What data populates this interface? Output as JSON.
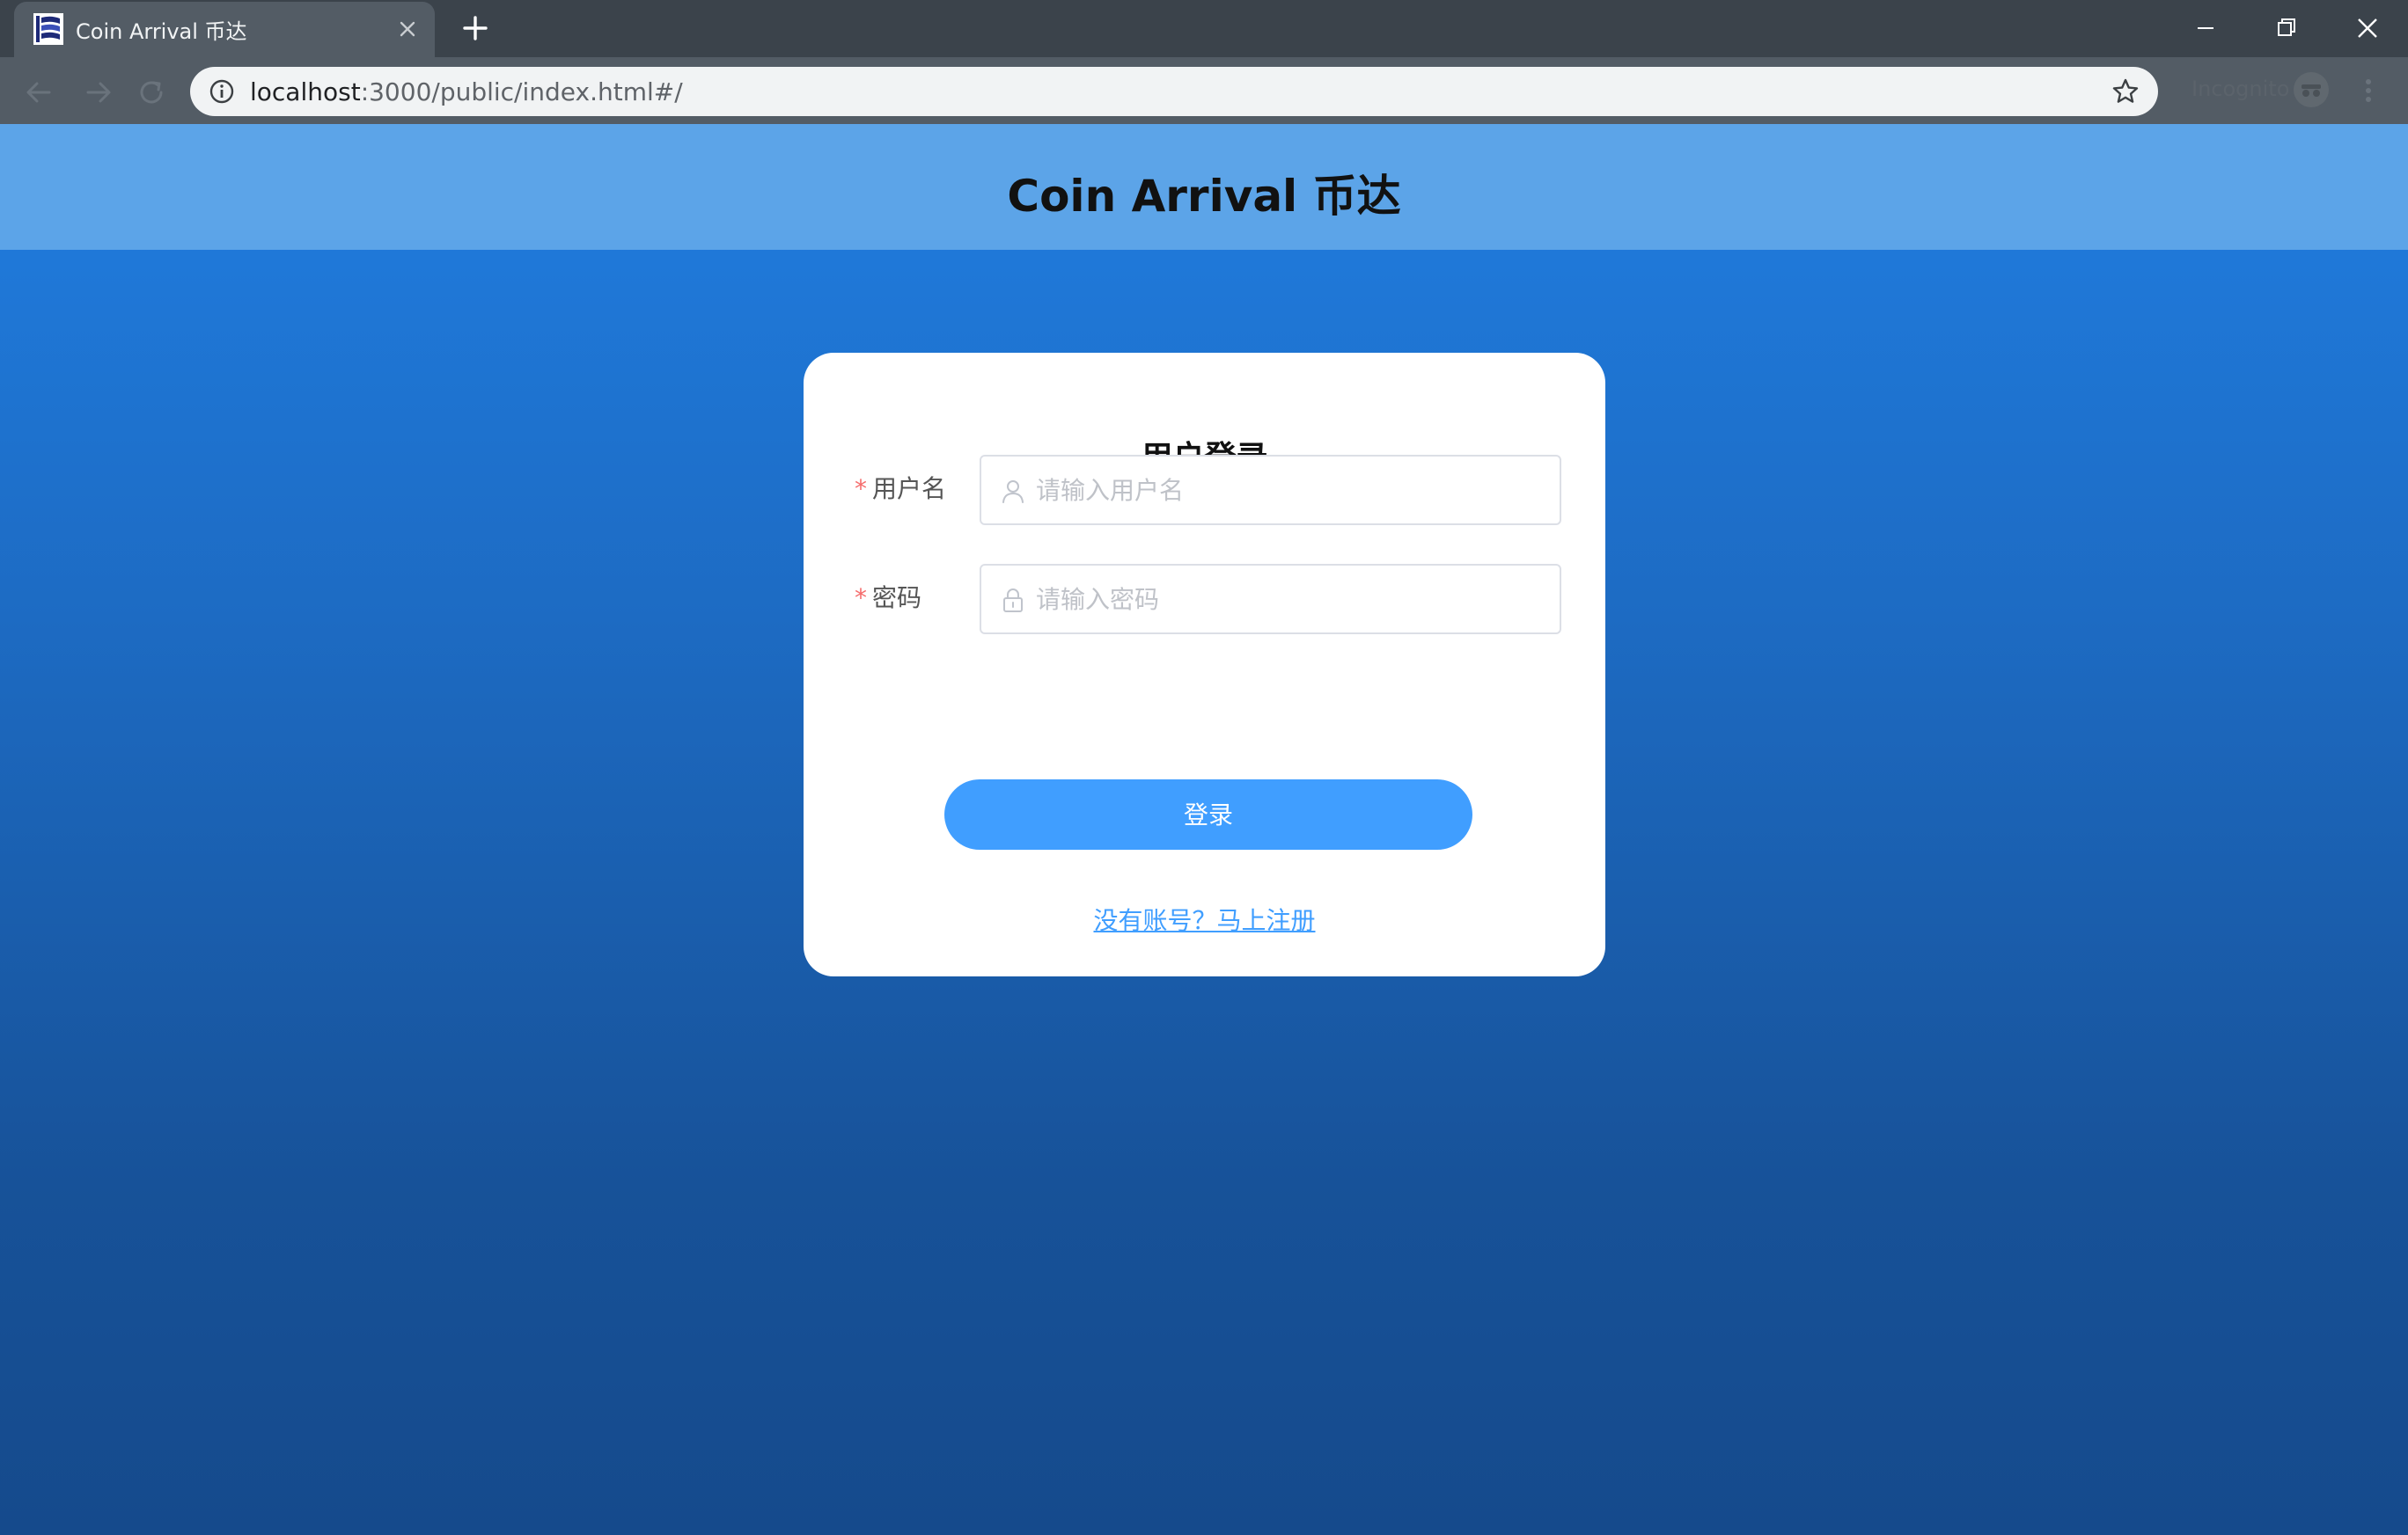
{
  "browser": {
    "tab": {
      "title": "Coin Arrival 币达"
    },
    "address": {
      "host": "localhost",
      "path": ":3000/public/index.html#/"
    },
    "incognito_label": "Incognito"
  },
  "page": {
    "header": {
      "title": "Coin Arrival 币达"
    },
    "login_card": {
      "title": "用户登录",
      "required_mark": "*",
      "username": {
        "label": "用户名",
        "placeholder": "请输入用户名",
        "value": ""
      },
      "password": {
        "label": "密码",
        "placeholder": "请输入密码",
        "value": ""
      },
      "login_button": "登录",
      "register_link": "没有账号？马上注册"
    }
  },
  "colors": {
    "header_bg": "#5ca4e8",
    "page_gradient_top": "#207de0",
    "page_gradient_bottom": "#154a8c",
    "primary": "#409eff",
    "required": "#f56c6c"
  }
}
